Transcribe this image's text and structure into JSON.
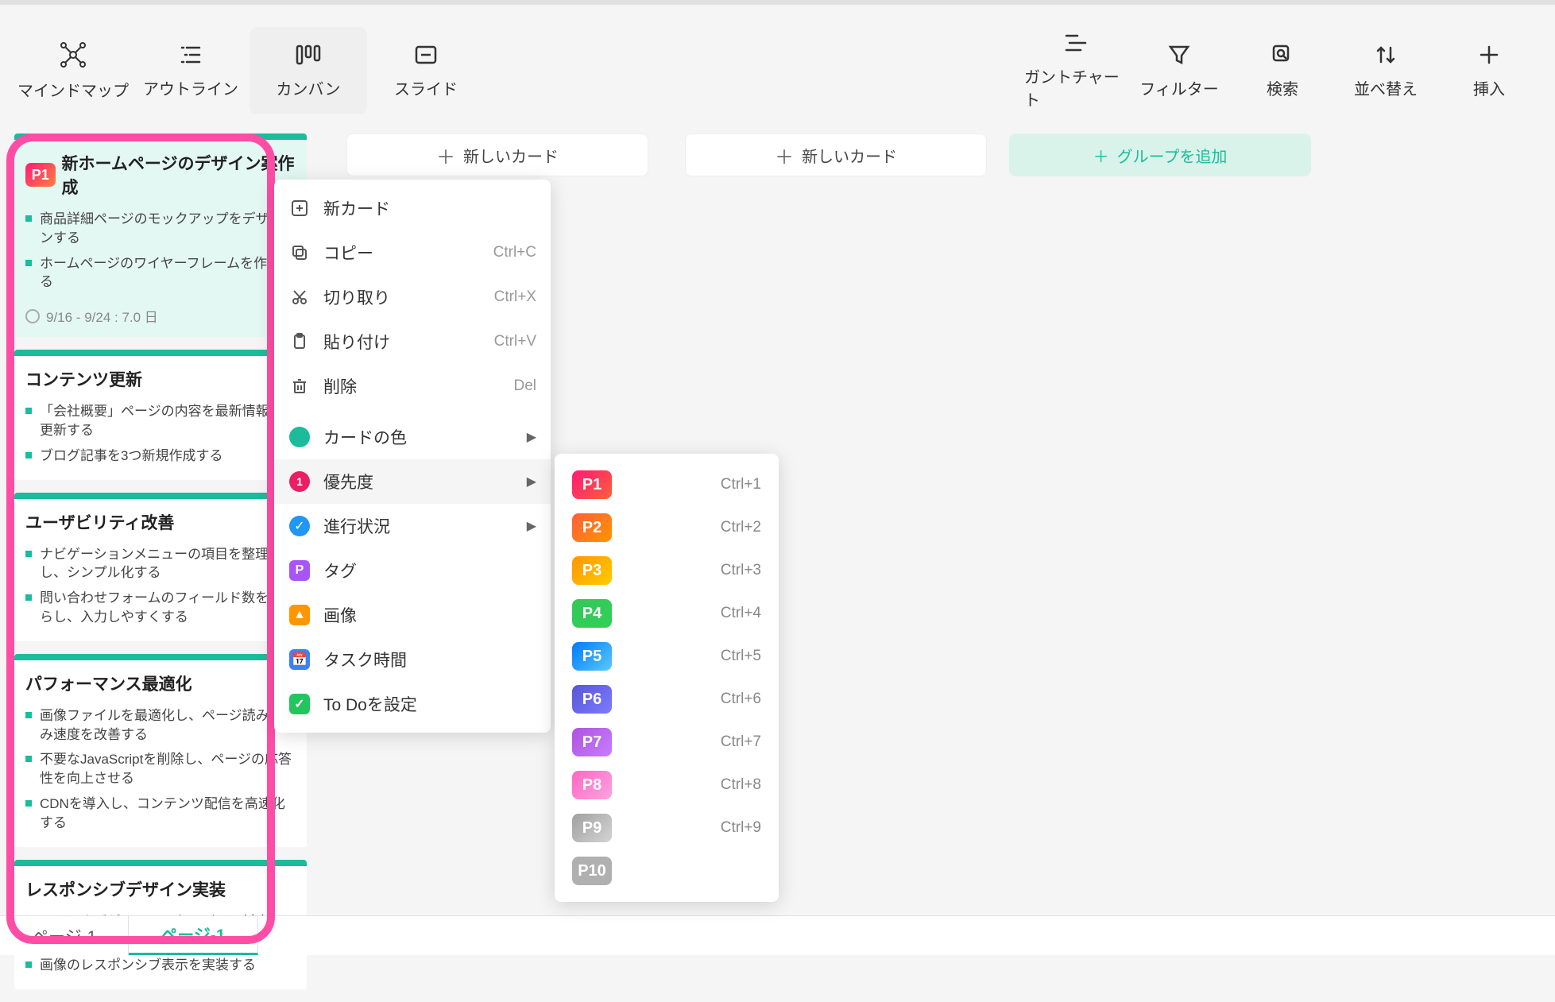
{
  "viewTabs": [
    {
      "label": "マインドマップ",
      "icon": "mindmap"
    },
    {
      "label": "アウトライン",
      "icon": "outline"
    },
    {
      "label": "カンバン",
      "icon": "kanban",
      "active": true
    },
    {
      "label": "スライド",
      "icon": "slide"
    }
  ],
  "toolbarRight": [
    {
      "label": "ガントチャート",
      "icon": "gantt"
    },
    {
      "label": "フィルター",
      "icon": "filter"
    },
    {
      "label": "検索",
      "icon": "search"
    },
    {
      "label": "並べ替え",
      "icon": "sort"
    },
    {
      "label": "挿入",
      "icon": "plus"
    }
  ],
  "newCardButtons": [
    {
      "label": "新しいカード"
    },
    {
      "label": "新しいカード"
    }
  ],
  "addGroup": {
    "label": "グループを追加"
  },
  "cards": [
    {
      "priority": "P1",
      "title": "新ホームページのデザイン案作成",
      "tasks": [
        "商品詳細ページのモックアップをデザインする",
        "ホームページのワイヤーフレームを作成する"
      ],
      "date": "9/16 - 9/24 : 7.0 日"
    },
    {
      "title": "コンテンツ更新",
      "tasks": [
        "「会社概要」ページの内容を最新情報に更新する",
        "ブログ記事を3つ新規作成する"
      ]
    },
    {
      "title": "ユーザビリティ改善",
      "tasks": [
        "ナビゲーションメニューの項目を整理し、シンプル化する",
        "問い合わせフォームのフィールド数を減らし、入力しやすくする"
      ]
    },
    {
      "title": "パフォーマンス最適化",
      "tasks": [
        "画像ファイルを最適化し、ページ読み込み速度を改善する",
        "不要なJavaScriptを削除し、ページの応答性を向上させる",
        "CDNを導入し、コンテンツ配信を高速化する"
      ]
    },
    {
      "title": "レスポンシブデザイン実装",
      "tasks": [
        "メインナビゲーションをモバイル対応のハンバーガーメニューに変更する",
        "画像のレスポンシブ表示を実装する"
      ]
    }
  ],
  "contextMenu": [
    {
      "label": "新カード",
      "icon": "plus-box",
      "shortcut": ""
    },
    {
      "label": "コピー",
      "icon": "copy",
      "shortcut": "Ctrl+C"
    },
    {
      "label": "切り取り",
      "icon": "cut",
      "shortcut": "Ctrl+X"
    },
    {
      "label": "貼り付け",
      "icon": "paste",
      "shortcut": "Ctrl+V"
    },
    {
      "label": "削除",
      "icon": "trash",
      "shortcut": "Del"
    },
    {
      "label": "カードの色",
      "icon": "dot-green",
      "arrow": true
    },
    {
      "label": "優先度",
      "icon": "dot-pink",
      "arrow": true,
      "hover": true
    },
    {
      "label": "進行状況",
      "icon": "dot-blue",
      "arrow": true
    },
    {
      "label": "タグ",
      "icon": "sq-purple"
    },
    {
      "label": "画像",
      "icon": "sq-orange"
    },
    {
      "label": "タスク時間",
      "icon": "sq-blue"
    },
    {
      "label": "To Doを設定",
      "icon": "sq-green"
    }
  ],
  "priorityMenu": [
    {
      "label": "P1",
      "class": "p1",
      "shortcut": "Ctrl+1"
    },
    {
      "label": "P2",
      "class": "p2",
      "shortcut": "Ctrl+2"
    },
    {
      "label": "P3",
      "class": "p3",
      "shortcut": "Ctrl+3"
    },
    {
      "label": "P4",
      "class": "p4",
      "shortcut": "Ctrl+4"
    },
    {
      "label": "P5",
      "class": "p5",
      "shortcut": "Ctrl+5"
    },
    {
      "label": "P6",
      "class": "p6",
      "shortcut": "Ctrl+6"
    },
    {
      "label": "P7",
      "class": "p7",
      "shortcut": "Ctrl+7"
    },
    {
      "label": "P8",
      "class": "p8",
      "shortcut": "Ctrl+8"
    },
    {
      "label": "P9",
      "class": "p9",
      "shortcut": "Ctrl+9"
    },
    {
      "label": "P10",
      "class": "p10",
      "shortcut": ""
    }
  ],
  "footerTabs": [
    {
      "label": "ページ-1",
      "active": false,
      "obscured": true
    },
    {
      "label": "ページ-1",
      "active": true
    }
  ]
}
